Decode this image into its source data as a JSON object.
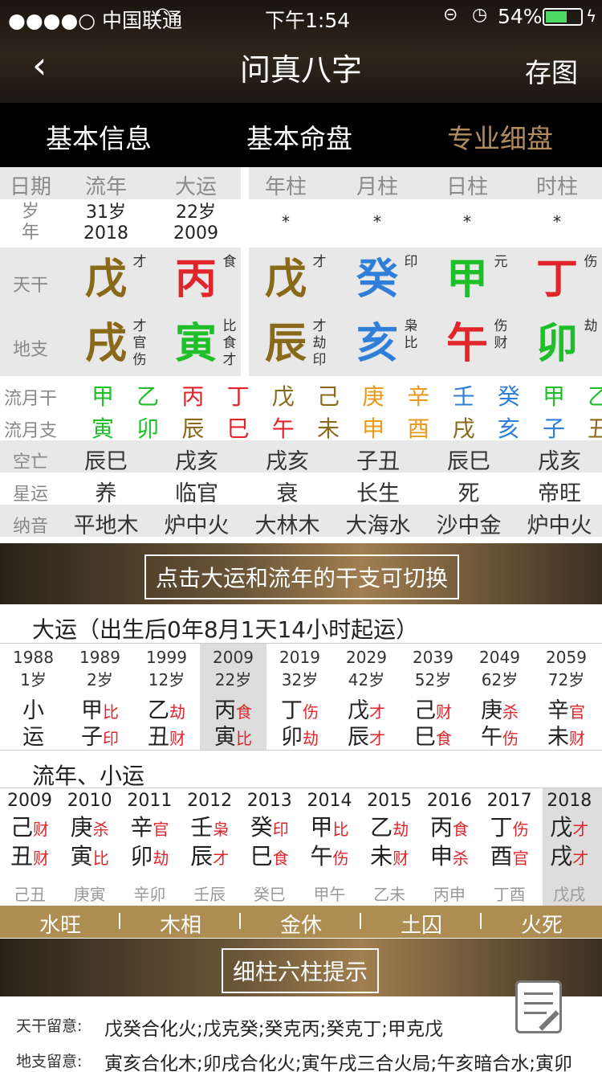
{
  "status": {
    "carrier": "●●●●○ 中国联通",
    "time": "下午1:54",
    "battery": "54%"
  },
  "nav": {
    "title": "问真八字",
    "save": "存图"
  },
  "tabs": [
    "基本信息",
    "基本命盘",
    "专业细盘"
  ],
  "col_headers": [
    "日期",
    "流年",
    "大运",
    "年柱",
    "月柱",
    "日柱",
    "时柱"
  ],
  "age_row": {
    "label1": "岁",
    "label2": "年",
    "liunian_age": "31岁",
    "liunian_year": "2018",
    "dayun_age": "22岁",
    "dayun_year": "2009",
    "stars": [
      "*",
      "*",
      "*",
      "*"
    ]
  },
  "tiangan": {
    "label": "天干",
    "items": [
      {
        "char": "戊",
        "sup": "才",
        "color": "#8a6a1a"
      },
      {
        "char": "丙",
        "sup": "食",
        "color": "#e0252b"
      },
      {
        "char": "戊",
        "sup": "才",
        "color": "#8a6a1a"
      },
      {
        "char": "癸",
        "sup": "印",
        "color": "#2f7fd8"
      },
      {
        "char": "甲",
        "sup": "元",
        "color": "#1fbf2a"
      },
      {
        "char": "丁",
        "sup": "伤",
        "color": "#e0252b"
      }
    ]
  },
  "dizhi": {
    "label": "地支",
    "items": [
      {
        "char": "戌",
        "sup": [
          "才",
          "官",
          "伤"
        ],
        "color": "#8a6a1a"
      },
      {
        "char": "寅",
        "sup": [
          "比",
          "食",
          "才"
        ],
        "color": "#1fbf2a"
      },
      {
        "char": "辰",
        "sup": [
          "才",
          "劫",
          "印"
        ],
        "color": "#8a6a1a"
      },
      {
        "char": "亥",
        "sup": [
          "枭",
          "比"
        ],
        "color": "#2f7fd8"
      },
      {
        "char": "午",
        "sup": [
          "伤",
          "财"
        ],
        "color": "#e0252b"
      },
      {
        "char": "卯",
        "sup": [
          "劫"
        ],
        "color": "#1fbf2a"
      }
    ]
  },
  "liuyue_gan": {
    "label": "流月干",
    "items": [
      {
        "c": "甲",
        "color": "#1fbf2a"
      },
      {
        "c": "乙",
        "color": "#1fbf2a"
      },
      {
        "c": "丙",
        "color": "#e0252b"
      },
      {
        "c": "丁",
        "color": "#e0252b"
      },
      {
        "c": "戊",
        "color": "#8a6a1a"
      },
      {
        "c": "己",
        "color": "#8a6a1a"
      },
      {
        "c": "庚",
        "color": "#e89a1a"
      },
      {
        "c": "辛",
        "color": "#e89a1a"
      },
      {
        "c": "壬",
        "color": "#2f7fd8"
      },
      {
        "c": "癸",
        "color": "#2f7fd8"
      },
      {
        "c": "甲",
        "color": "#1fbf2a"
      },
      {
        "c": "乙",
        "color": "#1fbf2a"
      }
    ]
  },
  "liuyue_zhi": {
    "label": "流月支",
    "items": [
      {
        "c": "寅",
        "color": "#1fbf2a"
      },
      {
        "c": "卯",
        "color": "#1fbf2a"
      },
      {
        "c": "辰",
        "color": "#8a6a1a"
      },
      {
        "c": "巳",
        "color": "#e0252b"
      },
      {
        "c": "午",
        "color": "#e0252b"
      },
      {
        "c": "未",
        "color": "#8a6a1a"
      },
      {
        "c": "申",
        "color": "#e89a1a"
      },
      {
        "c": "酉",
        "color": "#e89a1a"
      },
      {
        "c": "戌",
        "color": "#8a6a1a"
      },
      {
        "c": "亥",
        "color": "#2f7fd8"
      },
      {
        "c": "子",
        "color": "#2f7fd8"
      },
      {
        "c": "丑",
        "color": "#8a6a1a"
      }
    ]
  },
  "kongwang": {
    "label": "空亡",
    "items": [
      "辰巳",
      "戌亥",
      "戌亥",
      "子丑",
      "辰巳",
      "戌亥"
    ]
  },
  "xingyun": {
    "label": "星运",
    "items": [
      "养",
      "临官",
      "衰",
      "长生",
      "死",
      "帝旺"
    ]
  },
  "nayin": {
    "label": "纳音",
    "items": [
      "平地木",
      "炉中火",
      "大林木",
      "大海水",
      "沙中金",
      "炉中火"
    ]
  },
  "banner1": "点击大运和流年的干支可切换",
  "dayun_title": "大运（出生后0年8月1天14小时起运）",
  "dayun": [
    {
      "year": "1988",
      "age": "1岁",
      "g1": "小",
      "s1": "",
      "g2": "运",
      "s2": ""
    },
    {
      "year": "1989",
      "age": "2岁",
      "g1": "甲",
      "s1": "比",
      "g2": "子",
      "s2": "印"
    },
    {
      "year": "1999",
      "age": "12岁",
      "g1": "乙",
      "s1": "劫",
      "g2": "丑",
      "s2": "财"
    },
    {
      "year": "2009",
      "age": "22岁",
      "g1": "丙",
      "s1": "食",
      "g2": "寅",
      "s2": "比"
    },
    {
      "year": "2019",
      "age": "32岁",
      "g1": "丁",
      "s1": "伤",
      "g2": "卯",
      "s2": "劫"
    },
    {
      "year": "2029",
      "age": "42岁",
      "g1": "戊",
      "s1": "才",
      "g2": "辰",
      "s2": "才"
    },
    {
      "year": "2039",
      "age": "52岁",
      "g1": "己",
      "s1": "财",
      "g2": "巳",
      "s2": "食"
    },
    {
      "year": "2049",
      "age": "62岁",
      "g1": "庚",
      "s1": "杀",
      "g2": "午",
      "s2": "伤"
    },
    {
      "year": "2059",
      "age": "72岁",
      "g1": "辛",
      "s1": "官",
      "g2": "未",
      "s2": "财"
    }
  ],
  "liunian_title": "流年、小运",
  "liunian": [
    {
      "year": "2009",
      "g1": "己",
      "s1": "财",
      "g2": "丑",
      "s2": "财",
      "xy": "己丑"
    },
    {
      "year": "2010",
      "g1": "庚",
      "s1": "杀",
      "g2": "寅",
      "s2": "比",
      "xy": "庚寅"
    },
    {
      "year": "2011",
      "g1": "辛",
      "s1": "官",
      "g2": "卯",
      "s2": "劫",
      "xy": "辛卯"
    },
    {
      "year": "2012",
      "g1": "壬",
      "s1": "枭",
      "g2": "辰",
      "s2": "才",
      "xy": "壬辰"
    },
    {
      "year": "2013",
      "g1": "癸",
      "s1": "印",
      "g2": "巳",
      "s2": "食",
      "xy": "癸巳"
    },
    {
      "year": "2014",
      "g1": "甲",
      "s1": "比",
      "g2": "午",
      "s2": "伤",
      "xy": "甲午"
    },
    {
      "year": "2015",
      "g1": "乙",
      "s1": "劫",
      "g2": "未",
      "s2": "财",
      "xy": "乙未"
    },
    {
      "year": "2016",
      "g1": "丙",
      "s1": "食",
      "g2": "申",
      "s2": "杀",
      "xy": "丙申"
    },
    {
      "year": "2017",
      "g1": "丁",
      "s1": "伤",
      "g2": "酉",
      "s2": "官",
      "xy": "丁酉"
    },
    {
      "year": "2018",
      "g1": "戊",
      "s1": "才",
      "g2": "戌",
      "s2": "才",
      "xy": "戊戌"
    }
  ],
  "wuxing": [
    "水旺",
    "木相",
    "金休",
    "土囚",
    "火死"
  ],
  "banner2": "细柱六柱提示",
  "tips": [
    {
      "label": "天干留意:",
      "text": "戊癸合化火;戊克癸;癸克丙;癸克丁;甲克戊"
    },
    {
      "label": "地支留意:",
      "text": "寅亥合化木;卯戌合化火;寅午戌三合火局;午亥暗合水;寅卯"
    }
  ]
}
